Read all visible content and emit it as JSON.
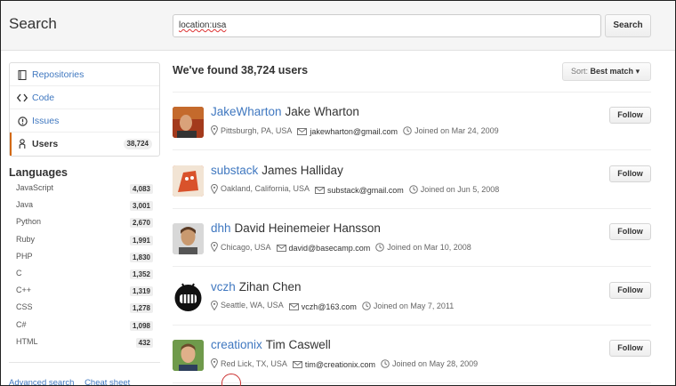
{
  "header": {
    "title": "Search",
    "search_value": "location:usa",
    "search_button": "Search"
  },
  "filters": [
    {
      "label": "Repositories",
      "icon": "repo-icon",
      "selected": false
    },
    {
      "label": "Code",
      "icon": "code-icon",
      "selected": false
    },
    {
      "label": "Issues",
      "icon": "issue-icon",
      "selected": false
    },
    {
      "label": "Users",
      "icon": "person-icon",
      "selected": true,
      "count": "38,724"
    }
  ],
  "languages": {
    "heading": "Languages",
    "items": [
      {
        "name": "JavaScript",
        "count": "4,083"
      },
      {
        "name": "Java",
        "count": "3,001"
      },
      {
        "name": "Python",
        "count": "2,670"
      },
      {
        "name": "Ruby",
        "count": "1,991"
      },
      {
        "name": "PHP",
        "count": "1,830"
      },
      {
        "name": "C",
        "count": "1,352"
      },
      {
        "name": "C++",
        "count": "1,319"
      },
      {
        "name": "CSS",
        "count": "1,278"
      },
      {
        "name": "C#",
        "count": "1,098"
      },
      {
        "name": "HTML",
        "count": "432"
      }
    ]
  },
  "footer_links": {
    "advanced": "Advanced search",
    "cheat": "Cheat sheet"
  },
  "results": {
    "heading": "We've found 38,724 users",
    "sort_prefix": "Sort:",
    "sort_value": "Best match",
    "follow_label": "Follow",
    "users": [
      {
        "login": "JakeWharton",
        "name": "Jake Wharton",
        "location": "Pittsburgh, PA, USA",
        "email": "jakewharton@gmail.com",
        "joined": "Joined on Mar 24, 2009",
        "avatar_color": "#b8542a"
      },
      {
        "login": "substack",
        "name": "James Halliday",
        "location": "Oakland, California, USA",
        "email": "substack@gmail.com",
        "joined": "Joined on Jun 5, 2008",
        "avatar_color": "#d9522b"
      },
      {
        "login": "dhh",
        "name": "David Heinemeier Hansson",
        "location": "Chicago, USA",
        "email": "david@basecamp.com",
        "joined": "Joined on Mar 10, 2008",
        "avatar_color": "#c9c9c9"
      },
      {
        "login": "vczh",
        "name": "Zihan Chen",
        "location": "Seattle, WA, USA",
        "email": "vczh@163.com",
        "joined": "Joined on May 7, 2011",
        "avatar_color": "#111111"
      },
      {
        "login": "creationix",
        "name": "Tim Caswell",
        "location": "Red Lick, TX, USA",
        "email": "tim@creationix.com",
        "joined": "Joined on May 28, 2009",
        "avatar_color": "#5f8f3f"
      }
    ]
  }
}
